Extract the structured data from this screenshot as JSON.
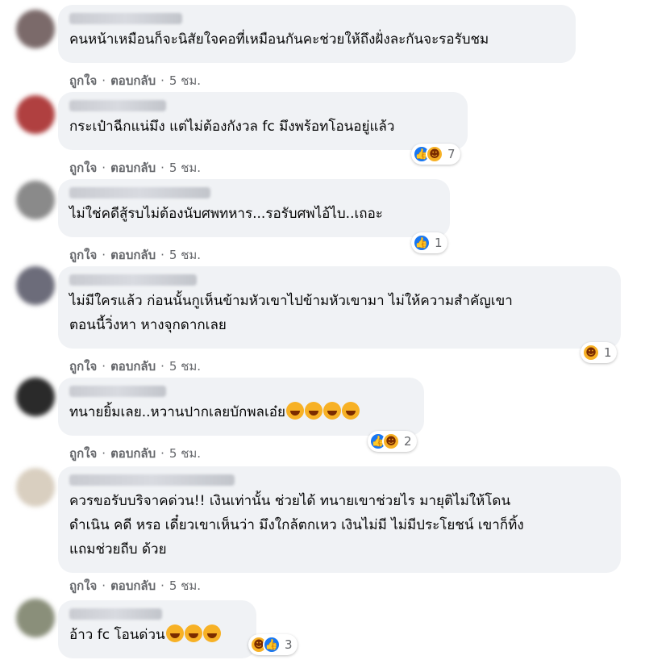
{
  "actions": {
    "like": "ถูกใจ",
    "reply": "ตอบกลับ",
    "sep": "·"
  },
  "comments": [
    {
      "text": [
        "คนหน้าเหมือนก็จะนิสัยใจคอที่เหมือนกันคะช่วยให้ถึงฝั่งละกันจะรอรับชม"
      ],
      "time": "5 ชม.",
      "reactions": null,
      "avatar_color": "#7b6a6a"
    },
    {
      "text": [
        "กระเป๋าฉีกแน่มึง แต่ไม่ต้องกังวล fc มึงพร้อทโอนอยู่แล้ว"
      ],
      "time": "5 ชม.",
      "reactions": {
        "icons": [
          "like-icon",
          "haha-icon"
        ],
        "count": "7"
      },
      "avatar_color": "#b04040"
    },
    {
      "text": [
        "ไม่ใช่คดีสู้รบไม่ต้องนับศพทหาร...รอรับศพไอ้ไบ..เถอะ"
      ],
      "time": "5 ชม.",
      "reactions": {
        "icons": [
          "like-icon"
        ],
        "count": "1"
      },
      "avatar_color": "#8a8a8a"
    },
    {
      "text": [
        "ไม่มีใครแล้ว ก่อนนั้นกูเห็นข้ามหัวเขาไปข้ามหัวเขามา ไม่ให้ความสำคัญเขา",
        "ตอนนี้วิ่งหา หางจุกดากเลย"
      ],
      "time": "5 ชม.",
      "reactions": {
        "icons": [
          "haha-icon"
        ],
        "count": "1"
      },
      "avatar_color": "#6c6c7a"
    },
    {
      "text": [
        "ทนายยิ้มเลย..หวานปากเลยบักพลเอ๋ย"
      ],
      "emoji_count": 4,
      "time": "5 ชม.",
      "reactions": {
        "icons": [
          "like-icon",
          "haha-icon"
        ],
        "count": "2"
      },
      "avatar_color": "#2a2a2a"
    },
    {
      "text": [
        "ควรขอรับบริจาคด่วน!! เงินเท่านั้น ช่วยได้ ทนายเขาช่วยไร มายุติไม่ให้โดน",
        "ดำเนิน คดี หรอ เดี๋ยวเขาเห็นว่า มึงใกล้ตกเหว เงินไม่มี ไม่มีประโยชน์ เขาก็ทิ้ง",
        "แถมช่วยถีบ ด้วย"
      ],
      "time": "5 ชม.",
      "reactions": null,
      "avatar_color": "#d9cfc0"
    },
    {
      "text": [
        "อ้าว fc โอนด่วน"
      ],
      "emoji_count": 3,
      "time": null,
      "reactions": {
        "icons": [
          "haha-icon",
          "like-icon"
        ],
        "count": "3"
      },
      "avatar_color": "#8a8f7a"
    }
  ]
}
